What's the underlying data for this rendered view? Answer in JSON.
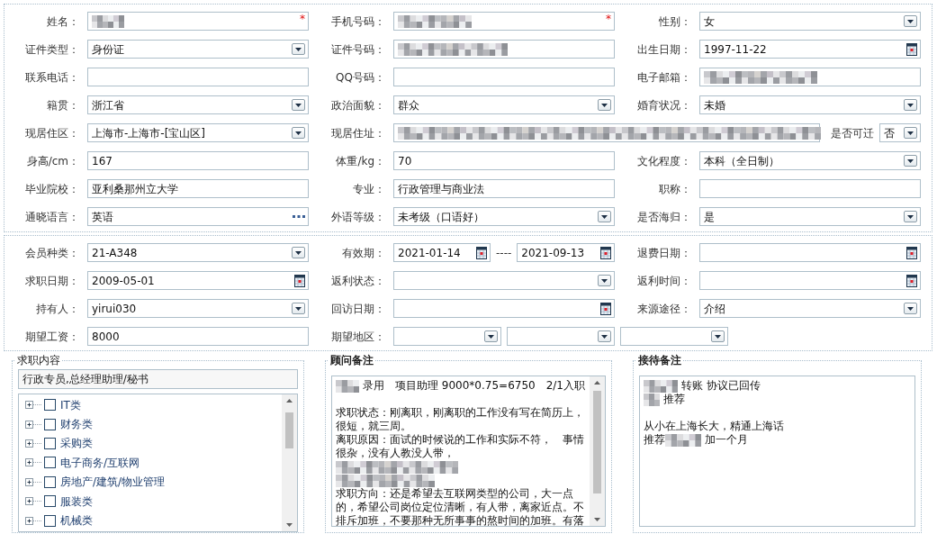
{
  "personal_section": {
    "rows": [
      [
        {
          "label": "姓名：",
          "kind": "text",
          "masked": true,
          "required_mark": "*"
        },
        {
          "label": "手机号码：",
          "kind": "text",
          "masked": true,
          "required_mark": "*"
        },
        {
          "label": "性别：",
          "kind": "select",
          "value": "女"
        }
      ],
      [
        {
          "label": "证件类型：",
          "kind": "select",
          "value": "身份证"
        },
        {
          "label": "证件号码：",
          "kind": "text",
          "masked": true
        },
        {
          "label": "出生日期：",
          "kind": "date",
          "value": "1997-11-22"
        }
      ],
      [
        {
          "label": "联系电话：",
          "kind": "text"
        },
        {
          "label": "QQ号码：",
          "kind": "text"
        },
        {
          "label": "电子邮箱：",
          "kind": "text",
          "masked": true
        }
      ],
      [
        {
          "label": "籍贯：",
          "kind": "select",
          "value": "浙江省"
        },
        {
          "label": "政治面貌：",
          "kind": "select",
          "value": "群众"
        },
        {
          "label": "婚育状况：",
          "kind": "select",
          "value": "未婚"
        }
      ],
      [
        {
          "label": "现居住区：",
          "kind": "select",
          "value": "上海市-上海市-[宝山区]"
        },
        {
          "label": "现居住址：",
          "kind": "text",
          "masked": true,
          "attached": {
            "label": "是否可迁",
            "kind": "select",
            "value": "否"
          }
        }
      ],
      [
        {
          "label": "身高/cm：",
          "kind": "text",
          "value": "167"
        },
        {
          "label": "体重/kg：",
          "kind": "text",
          "value": "70"
        },
        {
          "label": "文化程度：",
          "kind": "select",
          "value": "本科（全日制）"
        }
      ],
      [
        {
          "label": "毕业院校：",
          "kind": "text",
          "value": "亚利桑那州立大学"
        },
        {
          "label": "专业：",
          "kind": "text",
          "value": "行政管理与商业法"
        },
        {
          "label": "职称：",
          "kind": "text"
        }
      ],
      [
        {
          "label": "通晓语言：",
          "kind": "lookup",
          "value": "英语"
        },
        {
          "label": "外语等级：",
          "kind": "select",
          "value": "未考级（口语好）"
        },
        {
          "label": "是否海归：",
          "kind": "select",
          "value": "是"
        }
      ]
    ]
  },
  "membership_section": {
    "rows": [
      [
        {
          "label": "会员种类：",
          "kind": "select",
          "value": "21-A348"
        },
        {
          "label": "有效期：",
          "kind": "date_range",
          "from": "2021-01-14",
          "separator": "----",
          "to": "2021-09-13"
        },
        {
          "label": "退费日期：",
          "kind": "date"
        }
      ],
      [
        {
          "label": "求职日期：",
          "kind": "date",
          "value": "2009-05-01"
        },
        {
          "label": "返利状态：",
          "kind": "select"
        },
        {
          "label": "返利时间：",
          "kind": "date"
        }
      ],
      [
        {
          "label": "持有人：",
          "kind": "select",
          "value": "yirui030"
        },
        {
          "label": "回访日期：",
          "kind": "date"
        },
        {
          "label": "来源途径：",
          "kind": "select",
          "value": "介绍"
        }
      ],
      [
        {
          "label": "期望工资：",
          "kind": "text",
          "value": "8000"
        },
        {
          "label": "期望地区：",
          "kind": "select_group",
          "selects": [
            {
              "kind": "select"
            },
            {
              "kind": "select"
            },
            {
              "kind": "select"
            }
          ]
        }
      ]
    ]
  },
  "panels": [
    {
      "kind": "categories",
      "legend": "求职内容",
      "legend_bold": false,
      "summary": "行政专员,总经理助理/秘书",
      "categories": [
        {
          "label": "IT类",
          "checked": false,
          "expanded": false
        },
        {
          "label": "财务类",
          "checked": false,
          "expanded": false
        },
        {
          "label": "采购类",
          "checked": false,
          "expanded": false
        },
        {
          "label": "电子商务/互联网",
          "checked": false,
          "expanded": false
        },
        {
          "label": "房地产/建筑/物业管理",
          "checked": false,
          "expanded": false
        },
        {
          "label": "服装类",
          "checked": false,
          "expanded": false
        },
        {
          "label": "机械类",
          "checked": false,
          "expanded": false
        }
      ]
    },
    {
      "kind": "notes",
      "legend": "顾问备注",
      "legend_bold": true,
      "lines": [
        {
          "kind": "content",
          "segments": [
            {
              "kind": "mask"
            },
            {
              "kind": "text",
              "text": "录用　项目助理 9000*0.75=6750　2/1入职"
            }
          ]
        },
        {
          "kind": "blank"
        },
        {
          "kind": "content",
          "segments": [
            {
              "kind": "text",
              "text": "求职状态：刚离职，刚离职的工作没有写在简历上，"
            }
          ]
        },
        {
          "kind": "content",
          "segments": [
            {
              "kind": "text",
              "text": "很短，就三周。"
            }
          ]
        },
        {
          "kind": "content",
          "segments": [
            {
              "kind": "text",
              "text": "离职原因：面试的时候说的工作和实际不符，　事情"
            }
          ]
        },
        {
          "kind": "content",
          "segments": [
            {
              "kind": "text",
              "text": "很杂，没有人教没人带，"
            }
          ]
        },
        {
          "kind": "content",
          "segments": [
            {
              "kind": "mask"
            }
          ]
        },
        {
          "kind": "content",
          "segments": [
            {
              "kind": "mask"
            }
          ]
        },
        {
          "kind": "content",
          "segments": [
            {
              "kind": "text",
              "text": "求职方向：还是希望去互联网类型的公司，大一点"
            }
          ]
        },
        {
          "kind": "content",
          "segments": [
            {
              "kind": "text",
              "text": "的，希望公司岗位定位清晰，有人带，离家近点。不"
            }
          ]
        },
        {
          "kind": "content",
          "segments": [
            {
              "kind": "text",
              "text": "排斥加班，不要那种无所事事的熬时间的加班。有落"
            }
          ]
        }
      ]
    },
    {
      "kind": "notes",
      "legend": "接待备注",
      "legend_bold": true,
      "lines": [
        {
          "kind": "content",
          "segments": [
            {
              "kind": "mask"
            },
            {
              "kind": "text",
              "text": "转账 协议已回传"
            }
          ]
        },
        {
          "kind": "content",
          "segments": [
            {
              "kind": "mask"
            },
            {
              "kind": "text",
              "text": "推荐"
            }
          ]
        },
        {
          "kind": "blank"
        },
        {
          "kind": "content",
          "segments": [
            {
              "kind": "text",
              "text": "从小在上海长大，精通上海话"
            }
          ]
        },
        {
          "kind": "content",
          "segments": [
            {
              "kind": "text",
              "text": "推荐"
            },
            {
              "kind": "mask"
            },
            {
              "kind": "text",
              "text": "加一个月"
            }
          ]
        }
      ]
    }
  ]
}
